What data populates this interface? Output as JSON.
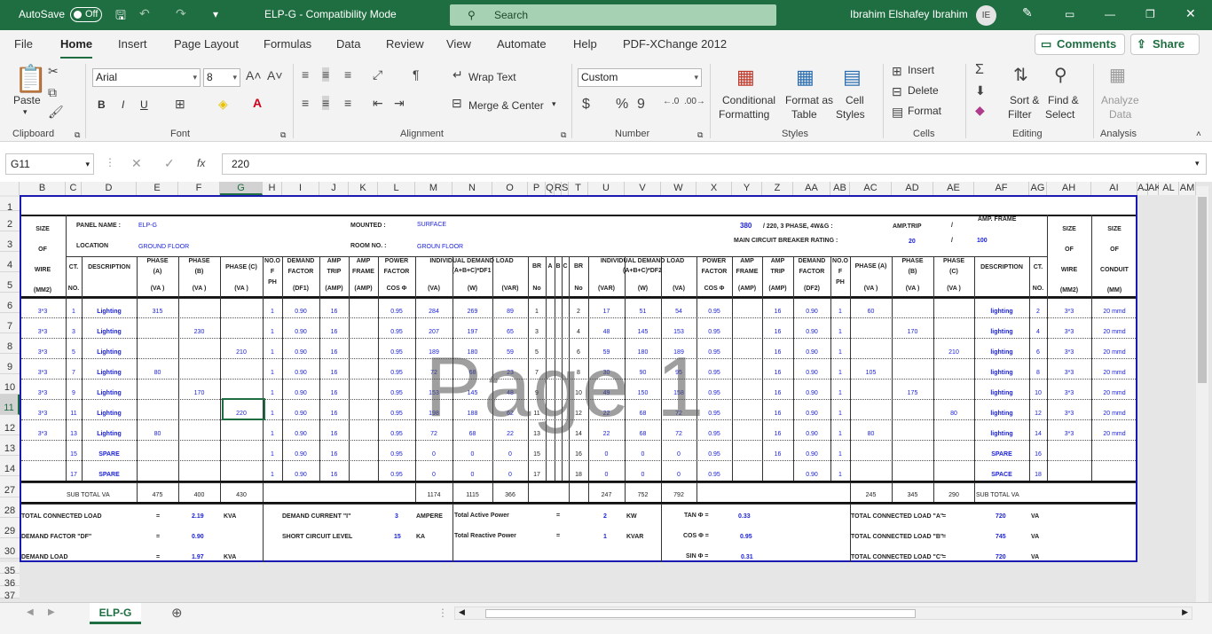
{
  "titlebar": {
    "autosave_label": "AutoSave",
    "autosave_state": "Off",
    "doc_title": "ELP-G  -  Compatibility Mode",
    "search_placeholder": "Search",
    "user_name": "Ibrahim Elshafey Ibrahim",
    "user_initials": "IE",
    "brand_color": "#1e6e41"
  },
  "menu": {
    "tabs": [
      "File",
      "Home",
      "Insert",
      "Page Layout",
      "Formulas",
      "Data",
      "Review",
      "View",
      "Automate",
      "Help",
      "PDF-XChange 2012"
    ],
    "comments": "Comments",
    "share": "Share"
  },
  "ribbon": {
    "clipboard": {
      "paste": "Paste",
      "group": "Clipboard"
    },
    "font": {
      "name": "Arial",
      "size": "8",
      "group": "Font",
      "bold": "B",
      "italic": "I",
      "underline": "U"
    },
    "alignment": {
      "wrap": "Wrap Text",
      "merge": "Merge & Center",
      "group": "Alignment"
    },
    "number": {
      "format": "Custom",
      "group": "Number"
    },
    "styles": {
      "conditional": [
        "Conditional",
        "Formatting"
      ],
      "table": [
        "Format as",
        "Table"
      ],
      "cell": [
        "Cell",
        "Styles"
      ],
      "group": "Styles"
    },
    "cells": {
      "insert": "Insert",
      "delete": "Delete",
      "format": "Format",
      "group": "Cells"
    },
    "editing": {
      "sort": [
        "Sort &",
        "Filter"
      ],
      "find": [
        "Find &",
        "Select"
      ],
      "group": "Editing"
    },
    "analysis": {
      "analyze": [
        "Analyze",
        "Data"
      ],
      "group": "Analysis"
    }
  },
  "formula_bar": {
    "name_box": "G11",
    "fx": "fx",
    "content": "220"
  },
  "columns": [
    "B",
    "C",
    "D",
    "E",
    "F",
    "G",
    "H",
    "I",
    "J",
    "K",
    "L",
    "M",
    "N",
    "O",
    "P",
    "Q",
    "R",
    "S",
    "T",
    "U",
    "V",
    "W",
    "X",
    "Y",
    "Z",
    "AA",
    "AB",
    "AC",
    "AD",
    "AE",
    "AF",
    "AG",
    "AH",
    "AI",
    "AJ",
    "AK",
    "AL",
    "AM"
  ],
  "row_numbers": [
    "1",
    "2",
    "3",
    "4",
    "5",
    "6",
    "7",
    "8",
    "9",
    "10",
    "11",
    "12",
    "13",
    "14",
    "27",
    "28",
    "29",
    "30",
    "35",
    "36",
    "37"
  ],
  "panel": {
    "size_of_wire": [
      "SIZE",
      "OF",
      "WIRE",
      "(MM2)"
    ],
    "panel_name_label": "PANEL NAME :",
    "panel_name": "ELP-G",
    "location_label": "LOCATION",
    "location": "GROUND FLOOR",
    "mounted_label": "MOUNTED  :",
    "mounted": "SURFACE",
    "room_label": "ROOM NO. :",
    "room": "GROUN FLOOR",
    "voltage": "380",
    "supply": "/ 220, 3 PHASE, 4W&G :",
    "breaker_label": "MAIN CIRCUIT BREAKER RATING :",
    "amp_trip_label": "AMP.TRIP",
    "amp_trip": "20",
    "amp_frame_label": "AMP. FRAME",
    "amp_frame": "100",
    "slash": "/",
    "size_of_conduit": [
      "SIZE",
      "OF",
      "CONDUIT",
      "(MM)"
    ]
  },
  "headers": {
    "ct": [
      "CT.",
      "NO."
    ],
    "description": "DESCRIPTION",
    "phase_a": [
      "PHASE",
      "(A)",
      "(VA )"
    ],
    "phase_b": [
      "PHASE",
      "(B)",
      "(VA )"
    ],
    "phase_c": [
      "PHASE  (C)",
      "(VA )"
    ],
    "no_of_ph": [
      "NO.O",
      "F",
      "PH"
    ],
    "demand_factor": [
      "DEMAND",
      "FACTOR",
      "(DF1)"
    ],
    "amp_trip": [
      "AMP",
      "TRIP",
      "(AMP)"
    ],
    "amp_frame": [
      "AMP",
      "FRAME",
      "(AMP)"
    ],
    "power_factor": [
      "POWER",
      "FACTOR",
      "COS Φ"
    ],
    "ind_demand_1": [
      "INDIVIDUAL DEMAND LOAD",
      "(A+B+C)*DF1"
    ],
    "units_1": [
      "(VA)",
      "(W)",
      "(VAR)"
    ],
    "br": [
      "BR",
      "No"
    ],
    "abc": [
      "A",
      "B",
      "C"
    ],
    "ind_demand_2": [
      "INDIVIDUAL DEMAND LOAD",
      "(A+B+C)*DF2"
    ],
    "units_2": [
      "(VAR)",
      "(W)",
      "(VA)"
    ],
    "demand_factor_2": [
      "DEMAND",
      "FACTOR",
      "(DF2)"
    ],
    "phase_a_r": [
      "PHASE  (A)",
      "(VA )"
    ],
    "phase_b_r": [
      "PHASE",
      "(B)",
      "(VA )"
    ],
    "phase_c_r": [
      "PHASE",
      "(C)",
      "(VA )"
    ],
    "wire": [
      "SIZE",
      "OF",
      "WIRE",
      "(MM2)"
    ],
    "conduit": [
      "SIZE",
      "OF",
      "CONDUIT",
      "(MM)"
    ]
  },
  "left_rows": [
    {
      "wire": "3*3",
      "ct": "1",
      "desc": "Lighting",
      "a": "315",
      "b": "",
      "c": "",
      "ph": "1",
      "df": "0.90",
      "trip": "16",
      "pf": "0.95",
      "va": "284",
      "w": "269",
      "var": "89",
      "br": "1"
    },
    {
      "wire": "3*3",
      "ct": "3",
      "desc": "Lighting",
      "a": "",
      "b": "230",
      "c": "",
      "ph": "1",
      "df": "0.90",
      "trip": "16",
      "pf": "0.95",
      "va": "207",
      "w": "197",
      "var": "65",
      "br": "3"
    },
    {
      "wire": "3*3",
      "ct": "5",
      "desc": "Lighting",
      "a": "",
      "b": "",
      "c": "210",
      "ph": "1",
      "df": "0.90",
      "trip": "16",
      "pf": "0.95",
      "va": "189",
      "w": "180",
      "var": "59",
      "br": "5"
    },
    {
      "wire": "3*3",
      "ct": "7",
      "desc": "Lighting",
      "a": "80",
      "b": "",
      "c": "",
      "ph": "1",
      "df": "0.90",
      "trip": "16",
      "pf": "0.95",
      "va": "72",
      "w": "68",
      "var": "23",
      "br": "7"
    },
    {
      "wire": "3*3",
      "ct": "9",
      "desc": "Lighting",
      "a": "",
      "b": "170",
      "c": "",
      "ph": "1",
      "df": "0.90",
      "trip": "16",
      "pf": "0.95",
      "va": "153",
      "w": "145",
      "var": "48",
      "br": "9"
    },
    {
      "wire": "3*3",
      "ct": "11",
      "desc": "Lighting",
      "a": "",
      "b": "",
      "c": "220",
      "ph": "1",
      "df": "0.90",
      "trip": "16",
      "pf": "0.95",
      "va": "198",
      "w": "188",
      "var": "62",
      "br": "11"
    },
    {
      "wire": "3*3",
      "ct": "13",
      "desc": "Lighting",
      "a": "80",
      "b": "",
      "c": "",
      "ph": "1",
      "df": "0.90",
      "trip": "16",
      "pf": "0.95",
      "va": "72",
      "w": "68",
      "var": "22",
      "br": "13"
    },
    {
      "wire": "",
      "ct": "15",
      "desc": "SPARE",
      "a": "",
      "b": "",
      "c": "",
      "ph": "1",
      "df": "0.90",
      "trip": "16",
      "pf": "0.95",
      "va": "0",
      "w": "0",
      "var": "0",
      "br": "15"
    },
    {
      "wire": "",
      "ct": "17",
      "desc": "SPARE",
      "a": "",
      "b": "",
      "c": "",
      "ph": "1",
      "df": "0.90",
      "trip": "16",
      "pf": "0.95",
      "va": "0",
      "w": "0",
      "var": "0",
      "br": "17"
    }
  ],
  "right_rows": [
    {
      "br": "2",
      "var": "17",
      "w": "51",
      "va": "54",
      "pf": "0.95",
      "trip": "16",
      "df": "0.90",
      "ph": "1",
      "a": "60",
      "b": "",
      "c": "",
      "desc": "lighting",
      "ct": "2",
      "wire": "3*3",
      "conduit": "20 mmd"
    },
    {
      "br": "4",
      "var": "48",
      "w": "145",
      "va": "153",
      "pf": "0.95",
      "trip": "16",
      "df": "0.90",
      "ph": "1",
      "a": "",
      "b": "170",
      "c": "",
      "desc": "lighting",
      "ct": "4",
      "wire": "3*3",
      "conduit": "20 mmd"
    },
    {
      "br": "6",
      "var": "59",
      "w": "180",
      "va": "189",
      "pf": "0.95",
      "trip": "16",
      "df": "0.90",
      "ph": "1",
      "a": "",
      "b": "",
      "c": "210",
      "desc": "lighting",
      "ct": "6",
      "wire": "3*3",
      "conduit": "20 mmd"
    },
    {
      "br": "8",
      "var": "30",
      "w": "90",
      "va": "95",
      "pf": "0.95",
      "trip": "16",
      "df": "0.90",
      "ph": "1",
      "a": "105",
      "b": "",
      "c": "",
      "desc": "lighting",
      "ct": "8",
      "wire": "3*3",
      "conduit": "20 mmd"
    },
    {
      "br": "10",
      "var": "49",
      "w": "150",
      "va": "158",
      "pf": "0.95",
      "trip": "16",
      "df": "0.90",
      "ph": "1",
      "a": "",
      "b": "175",
      "c": "",
      "desc": "lighting",
      "ct": "10",
      "wire": "3*3",
      "conduit": "20 mmd"
    },
    {
      "br": "12",
      "var": "22",
      "w": "68",
      "va": "72",
      "pf": "0.95",
      "trip": "16",
      "df": "0.90",
      "ph": "1",
      "a": "",
      "b": "",
      "c": "80",
      "desc": "lighting",
      "ct": "12",
      "wire": "3*3",
      "conduit": "20 mmd"
    },
    {
      "br": "14",
      "var": "22",
      "w": "68",
      "va": "72",
      "pf": "0.95",
      "trip": "16",
      "df": "0.90",
      "ph": "1",
      "a": "80",
      "b": "",
      "c": "",
      "desc": "lighting",
      "ct": "14",
      "wire": "3*3",
      "conduit": "20 mmd"
    },
    {
      "br": "16",
      "var": "0",
      "w": "0",
      "va": "0",
      "pf": "0.95",
      "trip": "16",
      "df": "0.90",
      "ph": "1",
      "a": "",
      "b": "",
      "c": "",
      "desc": "SPARE",
      "ct": "16",
      "wire": "",
      "conduit": ""
    },
    {
      "br": "18",
      "var": "0",
      "w": "0",
      "va": "0",
      "pf": "0.95",
      "trip": "",
      "df": "0.90",
      "ph": "1",
      "a": "",
      "b": "",
      "c": "",
      "desc": "SPACE",
      "ct": "18",
      "wire": "",
      "conduit": ""
    }
  ],
  "subtotal": {
    "label": "SUB TOTAL    VA",
    "a": "475",
    "b": "400",
    "c": "430",
    "va1": "1174",
    "w1": "1115",
    "var1": "366",
    "var2": "247",
    "w2": "752",
    "va2": "792",
    "ra": "245",
    "rb": "345",
    "rc": "290",
    "label2": "SUB TOTAL     VA"
  },
  "summary": {
    "tcl_label": "TOTAL CONNECTED LOAD",
    "tcl": "2.19",
    "tcl_unit": "KVA",
    "df_label": "DEMAND FACTOR   \"DF\"",
    "df": "0.90",
    "dl_label": "DEMAND LOAD",
    "dl": "1.97",
    "dl_unit": "KVA",
    "eq": "=",
    "dc_label": "DEMAND CURRENT  \"I\"",
    "dc": "3",
    "dc_unit": "AMPERE",
    "sc_label": "SHORT CIRCUIT LEVEL",
    "sc": "15",
    "sc_unit": "KA",
    "tap_label": "Total Active Power",
    "tap": "2",
    "tap_unit": "KW",
    "trp_label": "Total Reactive Power",
    "trp": "1",
    "trp_unit": "KVAR",
    "tan_label": "TAN Φ =",
    "tan": "0.33",
    "cos_label": "COS Φ =",
    "cos": "0.95",
    "sin_label": "SIN Φ =",
    "sin": "0.31",
    "tcla_label": "TOTAL CONNECTED LOAD \"A\"",
    "tcla": "720",
    "tclb_label": "TOTAL CONNECTED LOAD \"B\"",
    "tclb": "745",
    "tclc_label": "TOTAL CONNECTED LOAD \"C\"",
    "tclc": "720",
    "va": "VA"
  },
  "watermark": "Page 1",
  "sheet_tab": "ELP-G"
}
